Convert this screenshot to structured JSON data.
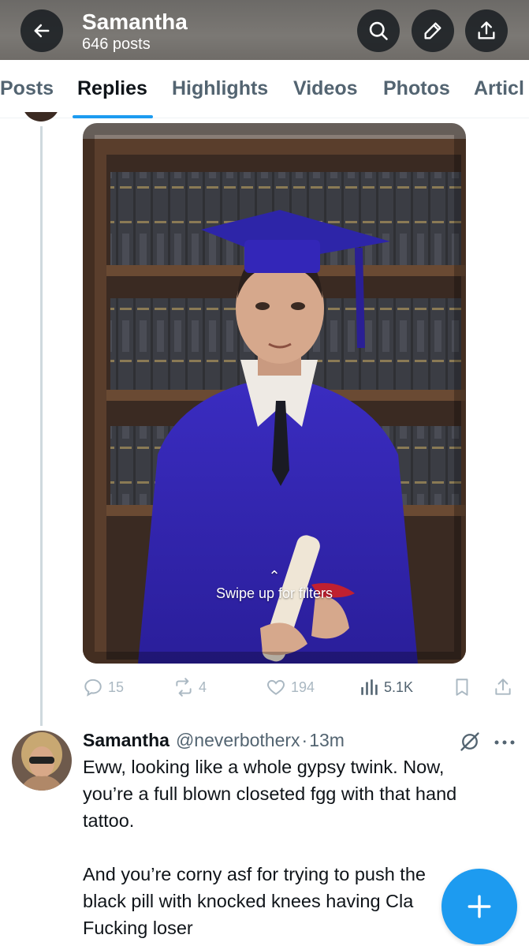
{
  "header": {
    "name": "Samantha",
    "post_count": "646 posts",
    "back_icon": "arrow-left-icon",
    "search_icon": "search-icon",
    "edit_icon": "pencil-icon",
    "share_icon": "share-icon"
  },
  "tabs": [
    {
      "label": "Posts",
      "active": false
    },
    {
      "label": "Replies",
      "active": true
    },
    {
      "label": "Highlights",
      "active": false
    },
    {
      "label": "Videos",
      "active": false
    },
    {
      "label": "Photos",
      "active": false
    },
    {
      "label": "Articl",
      "active": false
    }
  ],
  "media": {
    "overlay_text": "Swipe up for filters",
    "overlay_icon": "chevron-up-icon"
  },
  "actions": {
    "replies": "15",
    "reposts": "4",
    "likes": "194",
    "views": "5.1K",
    "bookmark_icon": "bookmark-icon",
    "share_icon": "share-icon"
  },
  "reply": {
    "name": "Samantha",
    "handle": "@neverbotherx",
    "separator": "·",
    "time": "13m",
    "lines": [
      "Eww, looking like a whole gypsy twink. Now,",
      "you’re a full blown closeted fgg with that hand",
      "tattoo.",
      "",
      "And you’re corny asf for trying to push the",
      "black pill with knocked knees having Cla",
      "Fucking loser"
    ]
  },
  "colors": {
    "accent": "#1d9bf0",
    "text_primary": "#0f1419",
    "text_secondary": "#536471"
  },
  "fab_icon": "plus-icon"
}
